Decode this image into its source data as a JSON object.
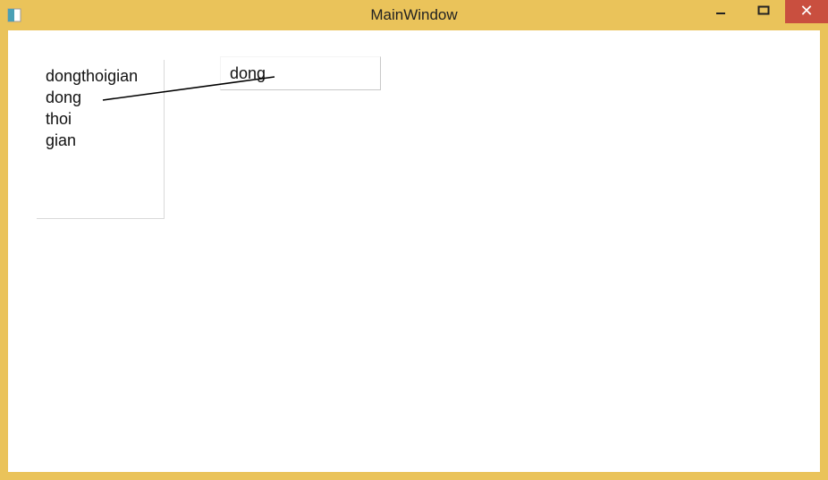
{
  "window": {
    "title": "MainWindow"
  },
  "listbox": {
    "items": [
      "dongthoigian",
      "dong",
      "thoi",
      "gian"
    ]
  },
  "textbox": {
    "value": "dong"
  }
}
